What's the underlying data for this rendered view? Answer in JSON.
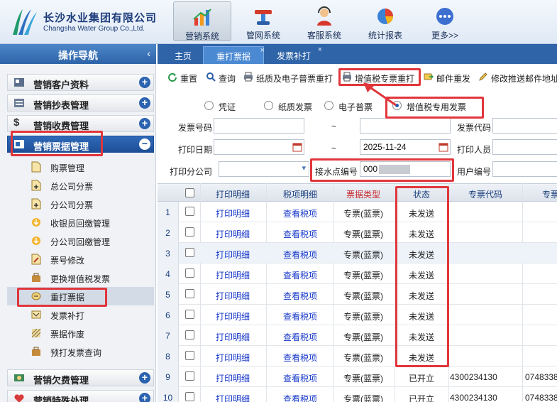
{
  "brand": {
    "name_cn": "长沙水业集团有限公司",
    "name_en": "Changsha Water Group Co.,Ltd."
  },
  "topnav": [
    {
      "label": "营销系统",
      "icon": "bar-chart-icon"
    },
    {
      "label": "管网系统",
      "icon": "pipeline-icon"
    },
    {
      "label": "客服系统",
      "icon": "customer-service-icon"
    },
    {
      "label": "统计报表",
      "icon": "pie-chart-icon"
    },
    {
      "label": "更多>>",
      "icon": "more-icon"
    }
  ],
  "sidebar": {
    "title": "操作导航",
    "collapse_glyph": "‹",
    "groups": [
      {
        "label": "营销客户资料",
        "toggle": "+"
      },
      {
        "label": "营销抄表管理",
        "toggle": "+"
      },
      {
        "label": "营销收费管理",
        "toggle": "+"
      },
      {
        "label": "营销票据管理",
        "toggle": "−"
      },
      {
        "label": "营销欠费管理",
        "toggle": "+"
      },
      {
        "label": "营销特殊处理",
        "toggle": "+"
      }
    ],
    "items": [
      {
        "label": "购票管理"
      },
      {
        "label": "总公司分票"
      },
      {
        "label": "分公司分票"
      },
      {
        "label": "收银员回缴管理"
      },
      {
        "label": "分公司回缴管理"
      },
      {
        "label": "票号修改"
      },
      {
        "label": "更换增值税发票"
      },
      {
        "label": "重打票据"
      },
      {
        "label": "发票补打"
      },
      {
        "label": "票据作废"
      },
      {
        "label": "预打发票查询"
      }
    ]
  },
  "tabs": [
    {
      "label": "主页"
    },
    {
      "label": "重打票据",
      "close": "×"
    },
    {
      "label": "发票补打",
      "close": "×"
    }
  ],
  "toolbar": {
    "reset": "重置",
    "query": "查询",
    "paper_reprint": "纸质及电子普票重打",
    "vat_reprint": "增值税专票重打",
    "mail_resend": "邮件重发",
    "modify_mail": "修改推送邮件地址"
  },
  "form": {
    "radios": {
      "voucher": "凭证",
      "paper": "纸质发票",
      "electronic": "电子普票",
      "vat": "增值税专用发票"
    },
    "invoice_no_label": "发票号码",
    "tilde": "~",
    "invoice_code_label": "发票代码",
    "print_date_label": "打印日期",
    "print_date_to": "2025-11-24",
    "printer_label": "打印人员",
    "branch_label": "打印分公司",
    "point_label": "接水点编号",
    "point_value": "000",
    "user_label": "用户编号"
  },
  "grid": {
    "headers": {
      "print_detail": "打印明细",
      "tax_detail": "税项明细",
      "type": "票据类型",
      "status": "状态",
      "code": "专票代码",
      "num": "专票"
    },
    "rows": [
      {
        "n": "1",
        "print": "打印明细",
        "tax": "查看税项",
        "type": "专票(蓝票)",
        "status": "未发送",
        "code": "",
        "num": ""
      },
      {
        "n": "2",
        "print": "打印明细",
        "tax": "查看税项",
        "type": "专票(蓝票)",
        "status": "未发送",
        "code": "",
        "num": ""
      },
      {
        "n": "3",
        "print": "打印明细",
        "tax": "查看税项",
        "type": "专票(蓝票)",
        "status": "未发送",
        "code": "",
        "num": ""
      },
      {
        "n": "4",
        "print": "打印明细",
        "tax": "查看税项",
        "type": "专票(蓝票)",
        "status": "未发送",
        "code": "",
        "num": ""
      },
      {
        "n": "5",
        "print": "打印明细",
        "tax": "查看税项",
        "type": "专票(蓝票)",
        "status": "未发送",
        "code": "",
        "num": ""
      },
      {
        "n": "6",
        "print": "打印明细",
        "tax": "查看税项",
        "type": "专票(蓝票)",
        "status": "未发送",
        "code": "",
        "num": ""
      },
      {
        "n": "7",
        "print": "打印明细",
        "tax": "查看税项",
        "type": "专票(蓝票)",
        "status": "未发送",
        "code": "",
        "num": ""
      },
      {
        "n": "8",
        "print": "打印明细",
        "tax": "查看税项",
        "type": "专票(蓝票)",
        "status": "未发送",
        "code": "",
        "num": ""
      },
      {
        "n": "9",
        "print": "打印明细",
        "tax": "查看税项",
        "type": "专票(蓝票)",
        "status": "已开立",
        "code": "4300234130",
        "num": "0748338"
      },
      {
        "n": "10",
        "print": "打印明细",
        "tax": "查看税项",
        "type": "专票(蓝票)",
        "status": "已开立",
        "code": "4300234130",
        "num": "0748338"
      }
    ]
  },
  "colors": {
    "accent": "#2f64a8",
    "highlight": "#e0363c",
    "link": "#1637c9"
  }
}
